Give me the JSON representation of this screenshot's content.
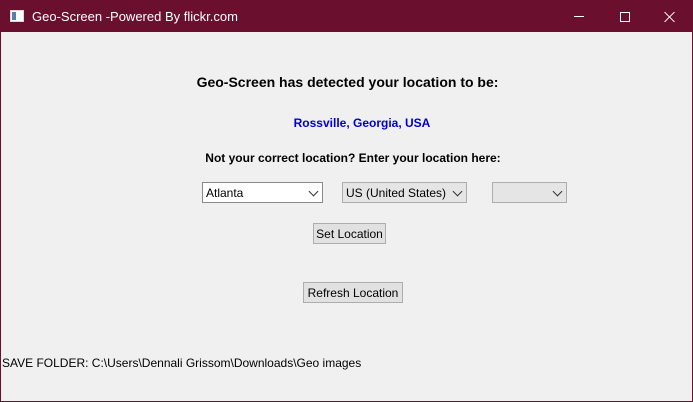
{
  "window": {
    "title": "Geo-Screen -Powered By flickr.com",
    "icon": "app-window-icon",
    "controls": {
      "minimize": "minimize-icon",
      "maximize": "maximize-icon",
      "close": "close-icon"
    }
  },
  "main": {
    "heading": "Geo-Screen has detected your location to be:",
    "detected_location": "Rossville, Georgia, USA",
    "prompt": "Not your correct location? Enter your location here:",
    "city_select": {
      "value": "Atlanta"
    },
    "country_select": {
      "value": "US (United States)"
    },
    "extra_select": {
      "value": ""
    },
    "set_location_label": "Set Location",
    "refresh_location_label": "Refresh Location"
  },
  "footer": {
    "save_folder_text": "SAVE FOLDER: C:\\Users\\Dennali Grissom\\Downloads\\Geo images"
  },
  "colors": {
    "titlebar": "#6b0f2f",
    "location_text": "#0000cc",
    "background": "#f0f0f0"
  }
}
